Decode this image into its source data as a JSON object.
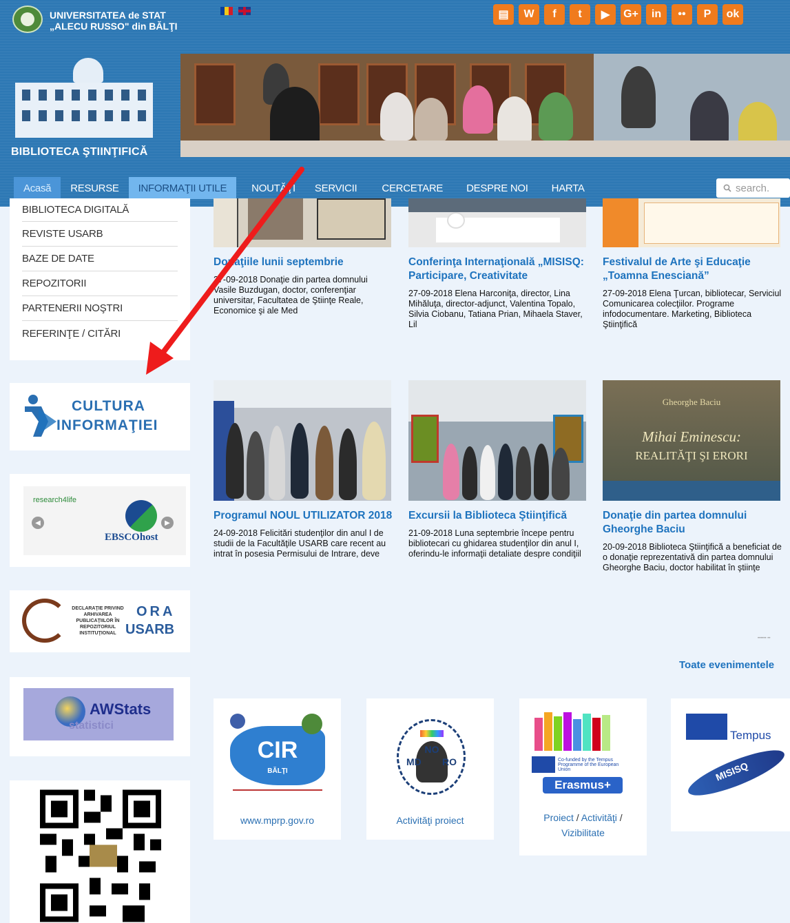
{
  "header": {
    "university_name_line1": "UNIVERSITATEA de STAT",
    "university_name_line2": "„ALECU RUSSO\" din BĂLŢI",
    "library_title": "BIBLIOTECA ŞTIINŢIFICĂ",
    "social_icons": [
      "news-icon",
      "wikipedia-icon",
      "facebook-icon",
      "twitter-icon",
      "youtube-icon",
      "google-plus-icon",
      "linkedin-icon",
      "flickr-icon",
      "pinterest-icon",
      "odnoklassniki-icon"
    ],
    "social_glyphs": [
      "▤",
      "W",
      "f",
      "t",
      "▶",
      "G+",
      "in",
      "••",
      "P",
      "ok"
    ],
    "social_colors": [
      "#f07b1d",
      "#f07b1d",
      "#f07b1d",
      "#f07b1d",
      "#f07b1d",
      "#f07b1d",
      "#f07b1d",
      "#f07b1d",
      "#f07b1d",
      "#f07b1d"
    ]
  },
  "nav": {
    "items": [
      "Acasă",
      "RESURSE",
      "INFORMAŢII UTILE",
      "NOUTĂŢI",
      "SERVICII",
      "CERCETARE",
      "DESPRE NOI",
      "HARTA"
    ],
    "search_placeholder": "search."
  },
  "sidebar": {
    "menu": [
      "BIBLIOTECA DIGITALĂ",
      "REVISTE USARB",
      "BAZE DE DATE",
      "REPOZITORII",
      "PARTENERII NOŞTRI",
      "REFERINŢE / CITĂRI"
    ],
    "cultura_line1": "CULTURA",
    "cultura_line2": "INFORMAŢIEI",
    "research4life": "research4life",
    "ebsco": "EBSCOhost",
    "ora_small": "DECLARAŢIE PRIVIND ARHIVAREA PUBLICAŢIILOR ÎN REPOZITORIUL INSTITUŢIONAL",
    "ora_big1": "ORA",
    "ora_big2": "USARB",
    "awstats_title": "AWStats",
    "awstats_sub": "statistici"
  },
  "news": [
    {
      "title": "Donaţiile lunii septembrie",
      "text": "27-09-2018 Donaţie din partea domnului Vasile Buzdugan, doctor, conferenţiar universitar, Facultatea de Ştiinţe Reale, Economice şi ale Med"
    },
    {
      "title": "Conferinţa Internaţională „MISISQ: Participare, Creativitate",
      "text": "27-09-2018 Elena Harconiţa, director, Lina Mihăluţa, director-adjunct, Valentina Topalo, Silvia Ciobanu, Tatiana Prian, Mihaela Staver, Lil"
    },
    {
      "title": "Festivalul de Arte şi Educaţie „Toamna Enesciană”",
      "text": "27-09-2018 Elena Ţurcan, bibliotecar, Serviciul Comunicarea colecţiilor. Programe infodocumentare. Marketing, Biblioteca Ştiinţifică"
    },
    {
      "title": "Programul NOUL UTILIZATOR 2018",
      "text": "24-09-2018 Felicitări studenţilor din anul I de studii de la Facultăţile USARB care recent au intrat în posesia Permisului de Intrare, deve"
    },
    {
      "title": "Excursii la Biblioteca Ştiinţifică",
      "text": "21-09-2018 Luna septembrie începe pentru bibliotecari cu ghidarea studenţilor din anul I, oferindu-le informaţii detaliate despre condiţiil"
    },
    {
      "title": "Donaţie din partea domnului Gheorghe Baciu",
      "text": "20-09-2018 Biblioteca Ştiinţifică a beneficiat de o donaţie reprezentativă din partea domnului Gheorghe Baciu, doctor habilitat în ştiinţe"
    }
  ],
  "book_cover": {
    "author": "Gheorghe Baciu",
    "title_line1": "Mihai Eminescu:",
    "title_line2": "REALITĂŢI ŞI ERORI"
  },
  "events_link": "Toate evenimentele",
  "partners": [
    {
      "logo_text": "CIR",
      "logo_sub": "BĂLŢI",
      "caption": "www.mprp.gov.ro"
    },
    {
      "logo_text_top": "NO",
      "logo_text_mid": "MD",
      "logo_text_right": "RO",
      "caption": "Activităţi proiect"
    },
    {
      "logo_text": "Erasmus+",
      "caption_parts": [
        "Proiect",
        " / ",
        "Activităţi",
        " / ",
        "Vizibilitate"
      ]
    },
    {
      "logo_text": "Tempus",
      "logo_sub": "MISISQ"
    }
  ]
}
